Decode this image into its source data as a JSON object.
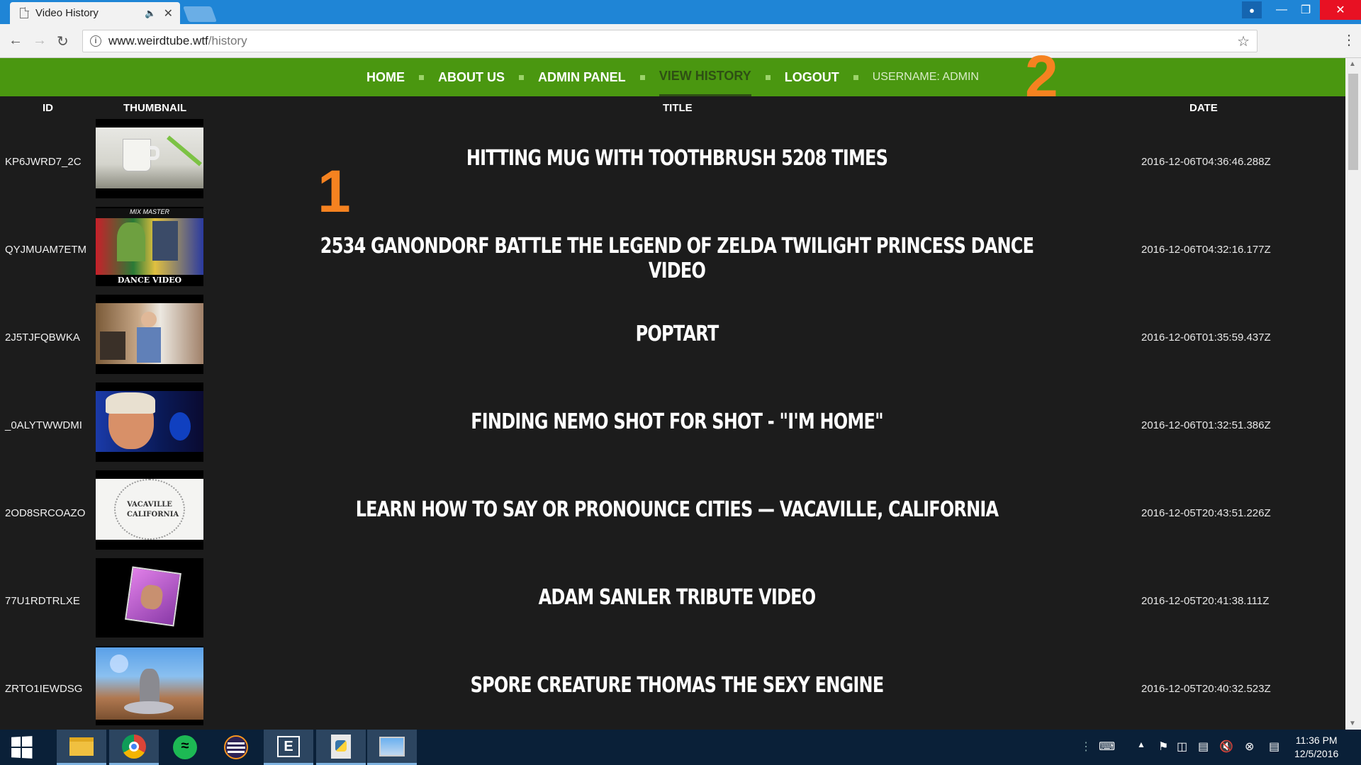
{
  "browser": {
    "tab_title": "Video History",
    "url_host": "www.weirdtube.wtf",
    "url_path": "/history"
  },
  "nav": {
    "home": "HOME",
    "about": "ABOUT US",
    "admin": "ADMIN PANEL",
    "history": "VIEW HISTORY",
    "logout": "LOGOUT",
    "username": "USERNAME: ADMIN"
  },
  "annotations": {
    "one": "1",
    "two": "2"
  },
  "table": {
    "headers": {
      "id": "ID",
      "thumbnail": "THUMBNAIL",
      "title": "TITLE",
      "date": "DATE"
    },
    "rows": [
      {
        "id": "KP6JWRD7_2C",
        "title": "HITTING MUG WITH TOOTHBRUSH 5208 TIMES",
        "date": "2016-12-06T04:36:46.288Z",
        "thumb": "mug"
      },
      {
        "id": "QYJMUAM7ETM",
        "title": "2534 GANONDORF BATTLE THE LEGEND OF ZELDA TWILIGHT PRINCESS DANCE VIDEO",
        "date": "2016-12-06T04:32:16.177Z",
        "thumb": "zelda",
        "thumb_text": "DANCE VIDEO"
      },
      {
        "id": "2J5TJFQBWKA",
        "title": "POPTART",
        "date": "2016-12-06T01:35:59.437Z",
        "thumb": "room"
      },
      {
        "id": "_0ALYTWWDMI",
        "title": "FINDING NEMO SHOT FOR SHOT - \"I'M HOME\"",
        "date": "2016-12-06T01:32:51.386Z",
        "thumb": "nemo"
      },
      {
        "id": "2OD8SRCOAZO",
        "title": "LEARN HOW TO SAY OR PRONOUNCE CITIES — VACAVILLE, CALIFORNIA",
        "date": "2016-12-05T20:43:51.226Z",
        "thumb": "vacaville",
        "thumb_text": "VACAVILLE CALIFORNIA"
      },
      {
        "id": "77U1RDTRLXE",
        "title": "ADAM SANLER TRIBUTE VIDEO",
        "date": "2016-12-05T20:41:38.111Z",
        "thumb": "album"
      },
      {
        "id": "ZRTO1IEWDSG",
        "title": "SPORE CREATURE THOMAS THE SEXY ENGINE",
        "date": "2016-12-05T20:40:32.523Z",
        "thumb": "spore"
      }
    ]
  },
  "taskbar": {
    "time": "11:36 PM",
    "date": "12/5/2016"
  },
  "colors": {
    "nav_green": "#4a9710",
    "annotation_orange": "#f58220",
    "page_bg": "#1c1c1c",
    "titlebar_blue": "#1f85d6"
  }
}
